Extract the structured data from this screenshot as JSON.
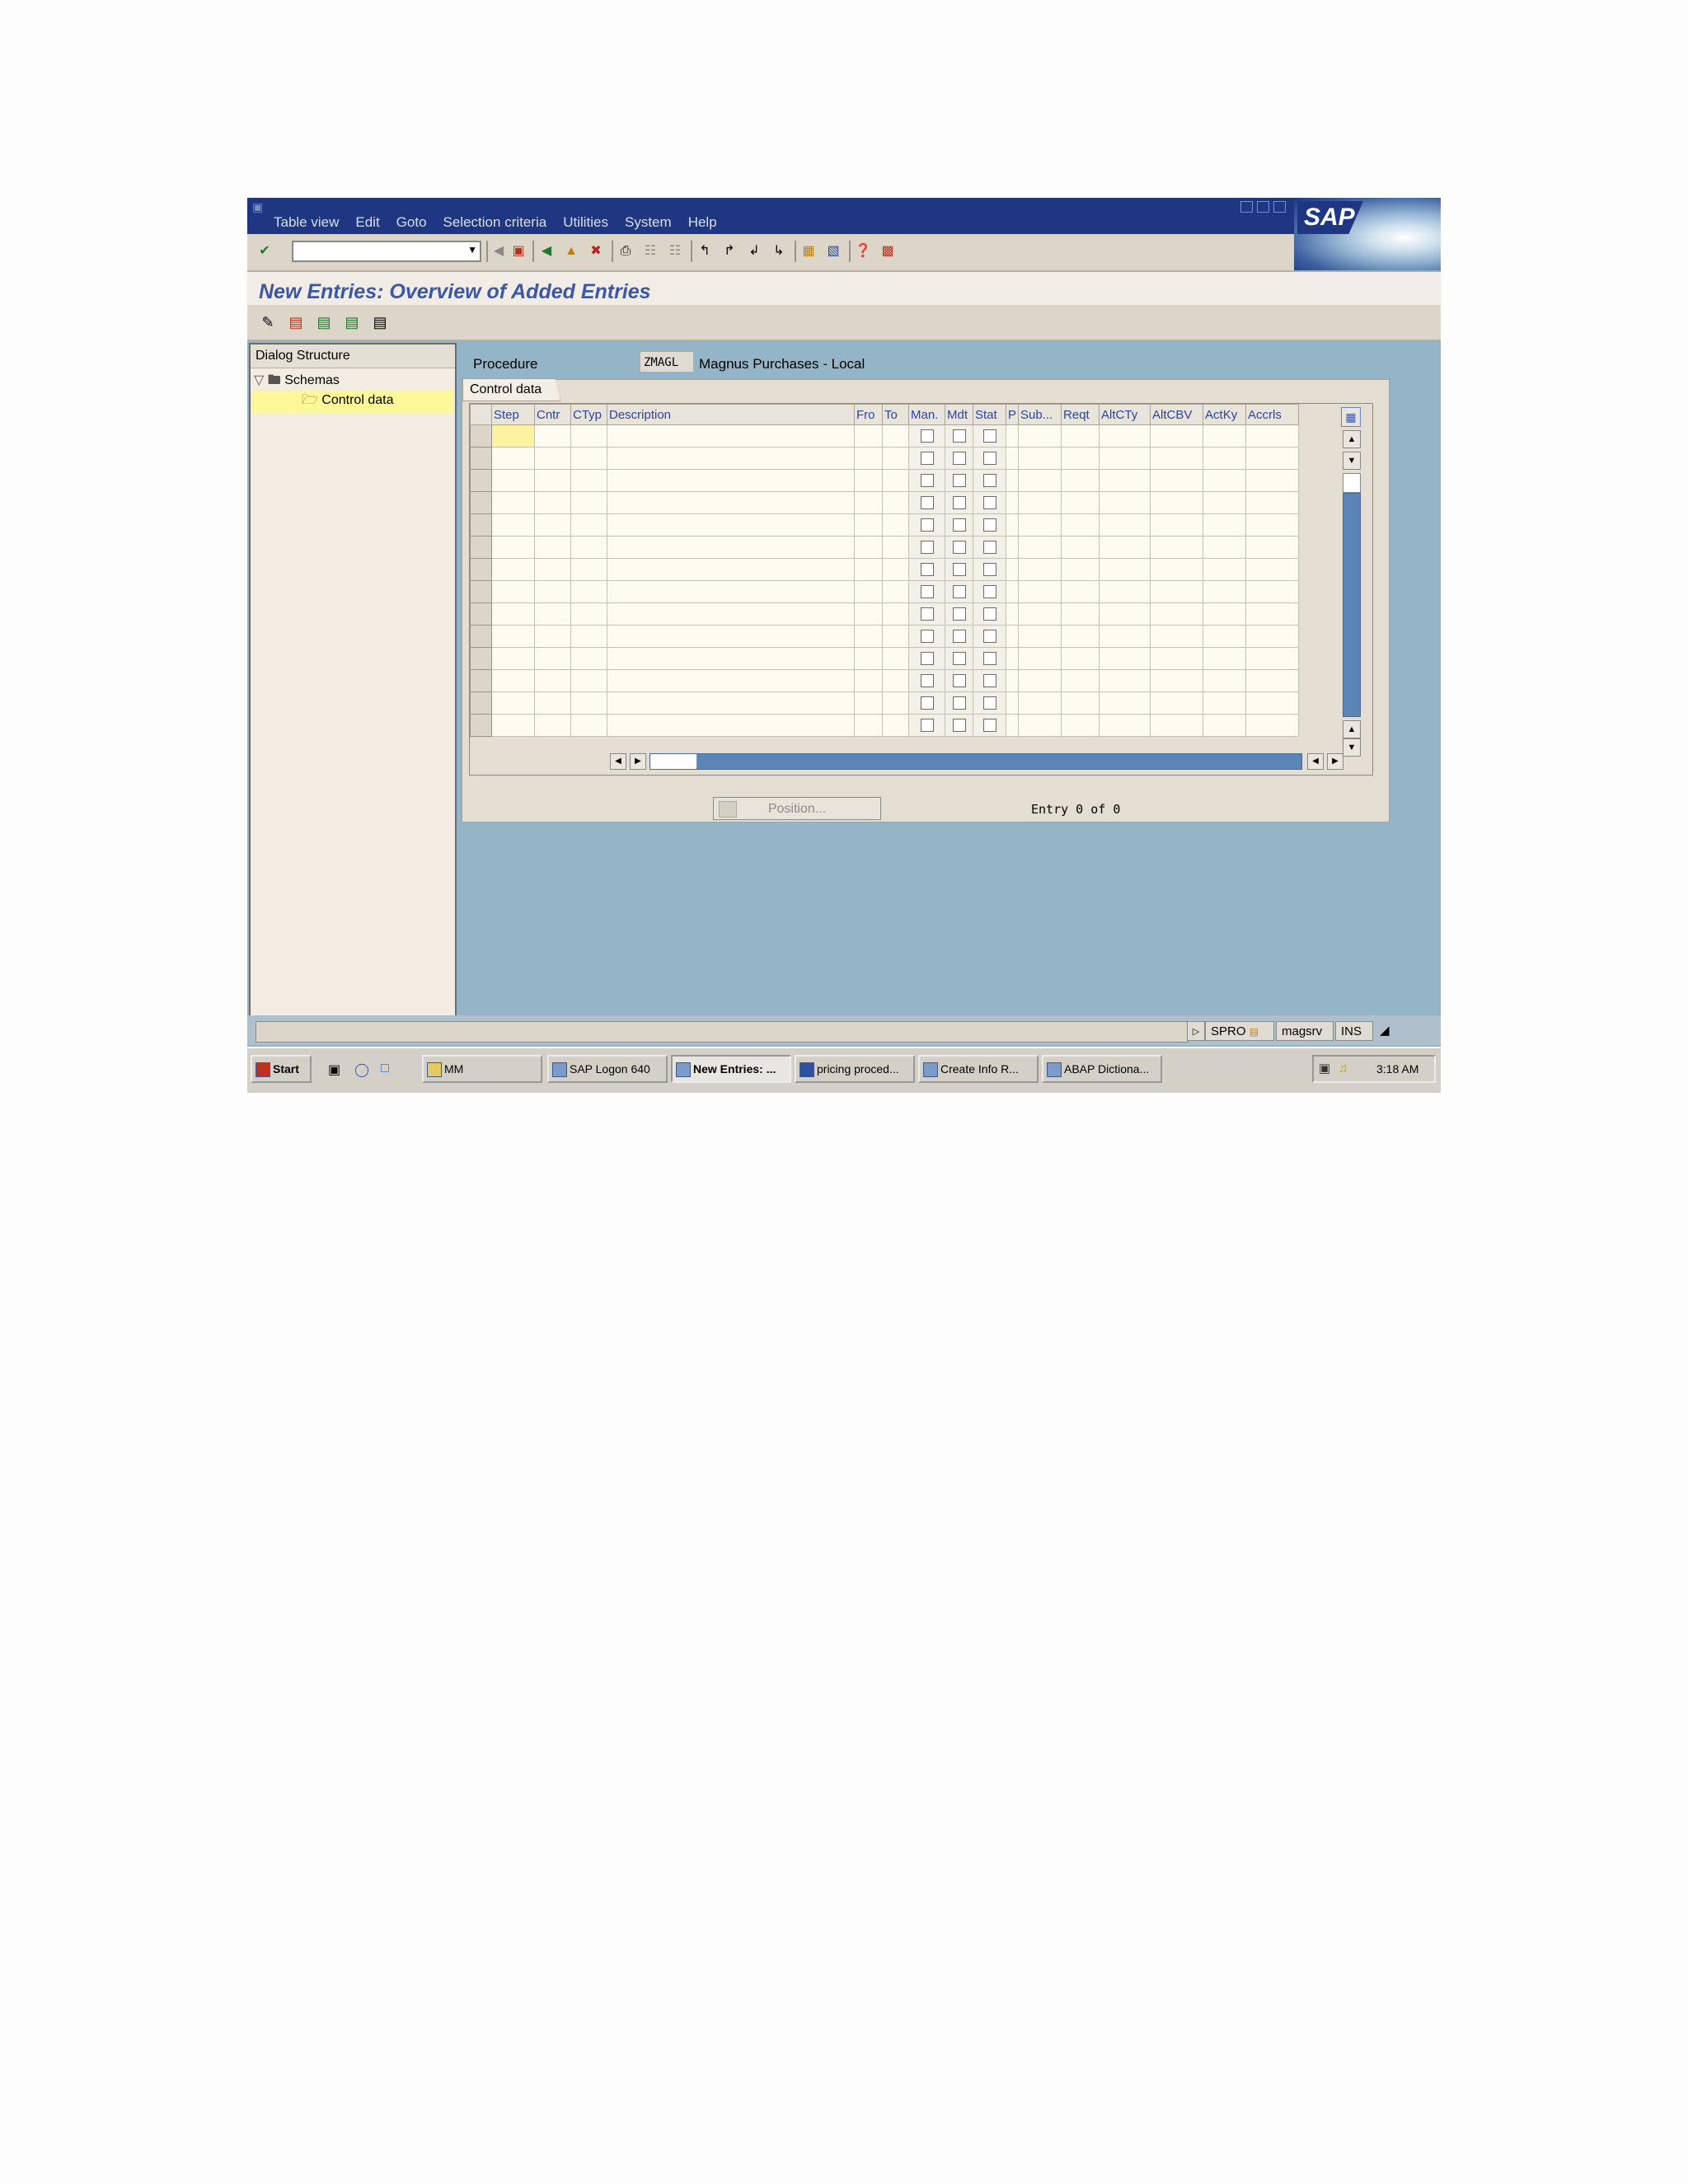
{
  "menu": {
    "items": [
      "Table view",
      "Edit",
      "Goto",
      "Selection criteria",
      "Utilities",
      "System",
      "Help"
    ]
  },
  "logo": {
    "text": "SAP"
  },
  "title": "New Entries: Overview of Added Entries",
  "dialog_structure": {
    "header": "Dialog Structure",
    "nodes": [
      "Schemas",
      "Control data"
    ]
  },
  "procedure": {
    "label": "Procedure",
    "value": "ZMAGL",
    "description": "Magnus Purchases - Local"
  },
  "tab": {
    "label": "Control data"
  },
  "table": {
    "columns": [
      "Step",
      "Cntr",
      "CTyp",
      "Description",
      "Fro",
      "To",
      "Man.",
      "Mdt",
      "Stat",
      "P",
      "Sub...",
      "Reqt",
      "AltCTy",
      "AltCBV",
      "ActKy",
      "Accrls"
    ],
    "checkbox_columns": [
      "Man.",
      "Mdt",
      "Stat"
    ],
    "row_count": 14,
    "rows": []
  },
  "position_button": "Position...",
  "entry_text": "Entry 0 of 0",
  "status": {
    "transaction": "SPRO",
    "server": "magsrv",
    "mode": "INS"
  },
  "taskbar": {
    "start": "Start",
    "tasks": [
      "MM",
      "SAP Logon 640",
      "New Entries: ...",
      "pricing proced...",
      "Create Info R...",
      "ABAP Dictiona..."
    ],
    "active_task": "New Entries: ...",
    "clock": "3:18 AM"
  },
  "colors": {
    "menubar": "#1f3683",
    "title": "#3c58a4",
    "background": "#94b4c8",
    "selected_row": "#fdf99a"
  }
}
